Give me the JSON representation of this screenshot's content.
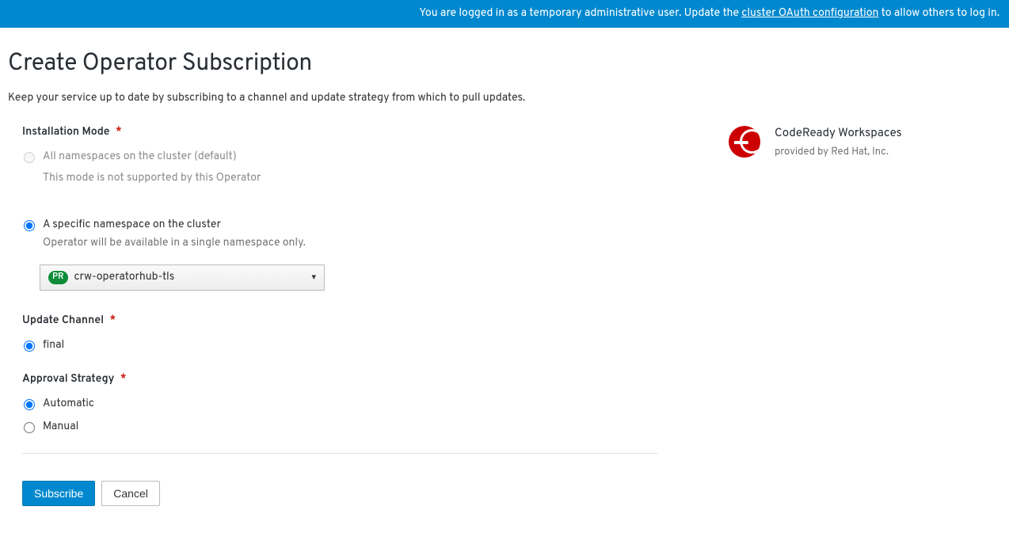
{
  "banner": {
    "prefix": "You are logged in as a temporary administrative user. Update the ",
    "link": "cluster OAuth configuration",
    "suffix": " to allow others to log in."
  },
  "page": {
    "title": "Create Operator Subscription",
    "description": "Keep your service up to date by subscribing to a channel and update strategy from which to pull updates."
  },
  "install_mode": {
    "label": "Installation Mode",
    "required": "*",
    "all": {
      "label": "All namespaces on the cluster (default)",
      "helper": "This mode is not supported by this Operator"
    },
    "specific": {
      "label": "A specific namespace on the cluster",
      "helper": "Operator will be available in a single namespace only."
    }
  },
  "namespace_select": {
    "badge": "PR",
    "value": "crw-operatorhub-tls"
  },
  "update_channel": {
    "label": "Update Channel",
    "required": "*",
    "option_final": "final"
  },
  "approval": {
    "label": "Approval Strategy",
    "required": "*",
    "auto": "Automatic",
    "manual": "Manual"
  },
  "buttons": {
    "subscribe": "Subscribe",
    "cancel": "Cancel"
  },
  "operator": {
    "name": "CodeReady Workspaces",
    "provider": "provided by Red Hat, Inc."
  }
}
